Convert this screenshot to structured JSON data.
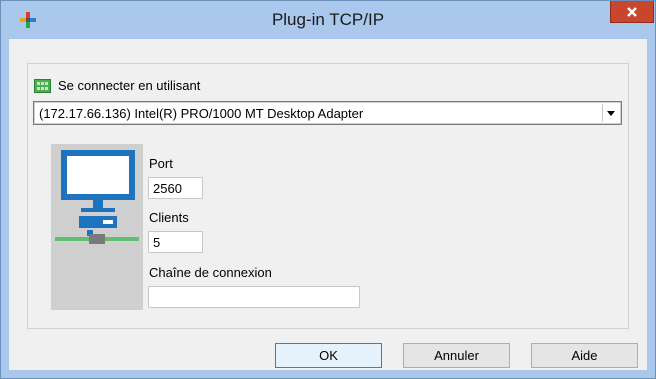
{
  "window": {
    "title": "Plug-in TCP/IP"
  },
  "connection": {
    "label": "Se connecter en utilisant",
    "selected_adapter": "(172.17.66.136) Intel(R) PRO/1000 MT Desktop Adapter"
  },
  "fields": {
    "port_label": "Port",
    "port_value": "2560",
    "clients_label": "Clients",
    "clients_value": "5",
    "conn_string_label": "Chaîne de connexion",
    "conn_string_value": ""
  },
  "buttons": {
    "ok": "OK",
    "cancel": "Annuler",
    "help": "Aide"
  },
  "icons": {
    "app": "plugin-cross-icon",
    "close": "close-icon",
    "network_adapter": "network-card-icon",
    "combo_arrow": "dropdown-arrow-icon",
    "computer": "computer-illustration"
  },
  "colors": {
    "titlebar": "#a9c8ec",
    "close_button": "#c7462d",
    "accent": "#1e73be"
  }
}
